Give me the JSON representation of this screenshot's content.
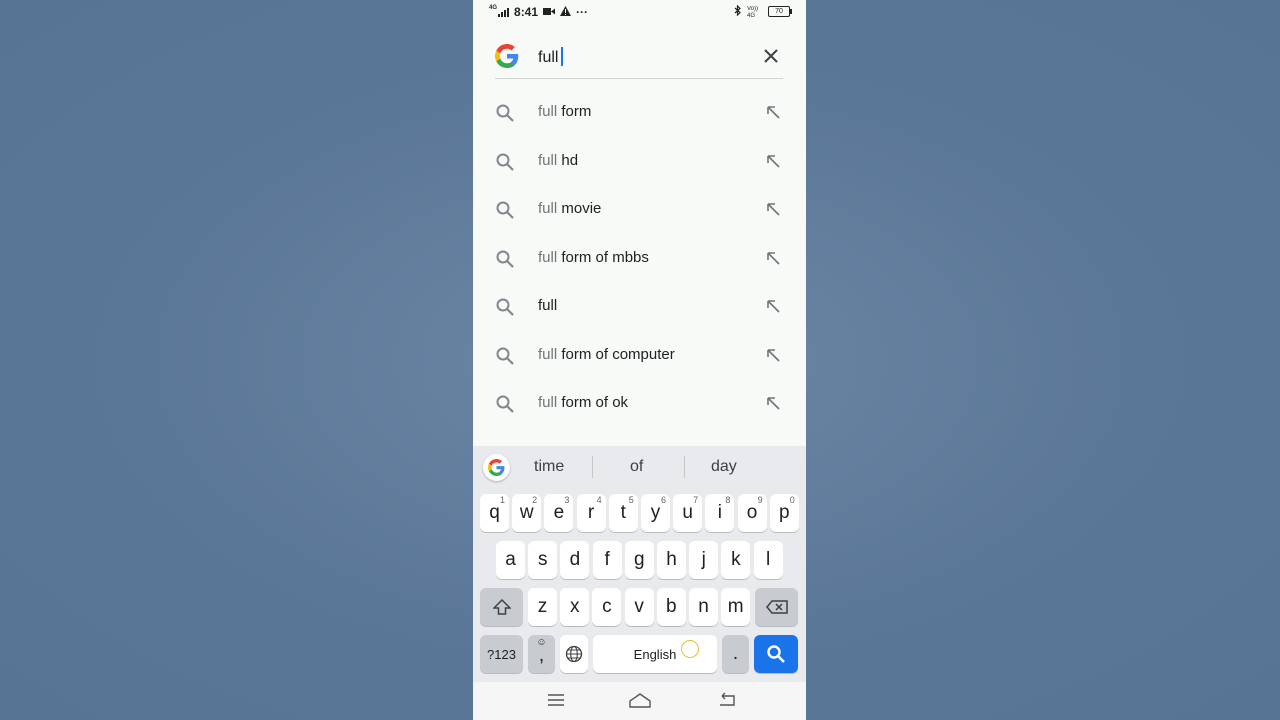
{
  "status_bar": {
    "time": "8:41",
    "network": "4G",
    "volte": "Vo)) 4G LTE",
    "battery": "70"
  },
  "search": {
    "query": "full",
    "icon": "google-g-icon",
    "clear_icon": "close-icon"
  },
  "suggestions": [
    {
      "prefix": "full",
      "rest": " form"
    },
    {
      "prefix": "full",
      "rest": " hd"
    },
    {
      "prefix": "full",
      "rest": " movie"
    },
    {
      "prefix": "full",
      "rest": " form of mbbs"
    },
    {
      "prefix": "",
      "rest": "full"
    },
    {
      "prefix": "full",
      "rest": " form of computer"
    },
    {
      "prefix": "full",
      "rest": " form of ok"
    }
  ],
  "keyboard": {
    "suggestions": [
      "time",
      "of",
      "day"
    ],
    "row1": [
      {
        "k": "q",
        "h": "1"
      },
      {
        "k": "w",
        "h": "2"
      },
      {
        "k": "e",
        "h": "3"
      },
      {
        "k": "r",
        "h": "4"
      },
      {
        "k": "t",
        "h": "5"
      },
      {
        "k": "y",
        "h": "6"
      },
      {
        "k": "u",
        "h": "7"
      },
      {
        "k": "i",
        "h": "8"
      },
      {
        "k": "o",
        "h": "9"
      },
      {
        "k": "p",
        "h": "0"
      }
    ],
    "row2": [
      "a",
      "s",
      "d",
      "f",
      "g",
      "h",
      "j",
      "k",
      "l"
    ],
    "row3": [
      "z",
      "x",
      "c",
      "v",
      "b",
      "n",
      "m"
    ],
    "symbols_label": "?123",
    "emoji_comma": ",",
    "space_label": "English",
    "period": "."
  },
  "colors": {
    "accent": "#1a73e8",
    "background": "#5e7a9a"
  }
}
